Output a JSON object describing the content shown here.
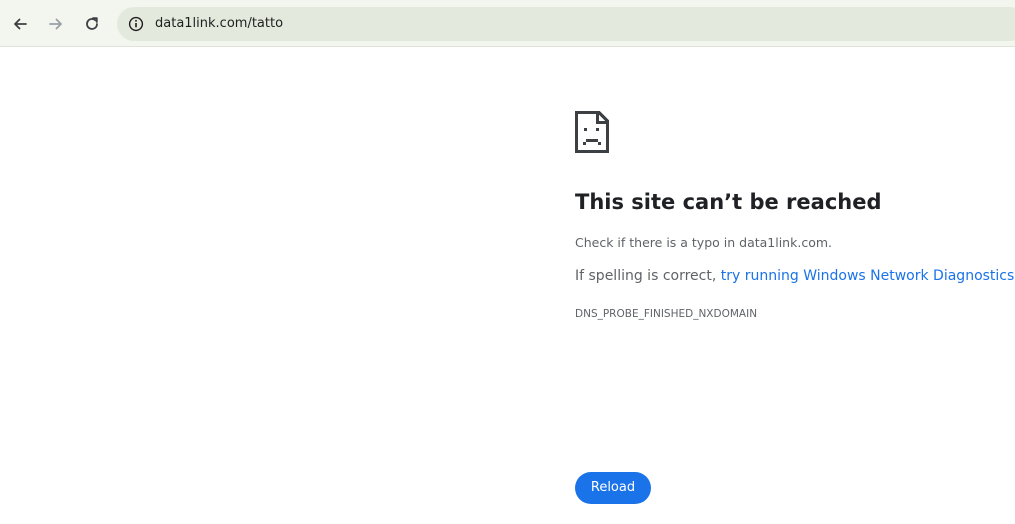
{
  "browser": {
    "url": "data1link.com/tatto",
    "icons": [
      "back-icon",
      "forward-icon",
      "reload-icon",
      "site-info-icon"
    ]
  },
  "error_page": {
    "icon": "sad-document-icon",
    "title": "This site can’t be reached",
    "line1": "Check if there is a typo in data1link.com.",
    "line2_prefix": "If spelling is correct, ",
    "line2_link": "try running Windows Network Diagnostics",
    "line2_suffix": ".",
    "error_code": "DNS_PROBE_FINISHED_NXDOMAIN",
    "reload_label": "Reload"
  },
  "colors": {
    "toolbar_bg": "#f3f6ee",
    "omnibox_bg": "#e3e9dd",
    "link": "#1a73e8",
    "button": "#1a73e8",
    "title_text": "#202124",
    "body_text": "#5f6368"
  }
}
